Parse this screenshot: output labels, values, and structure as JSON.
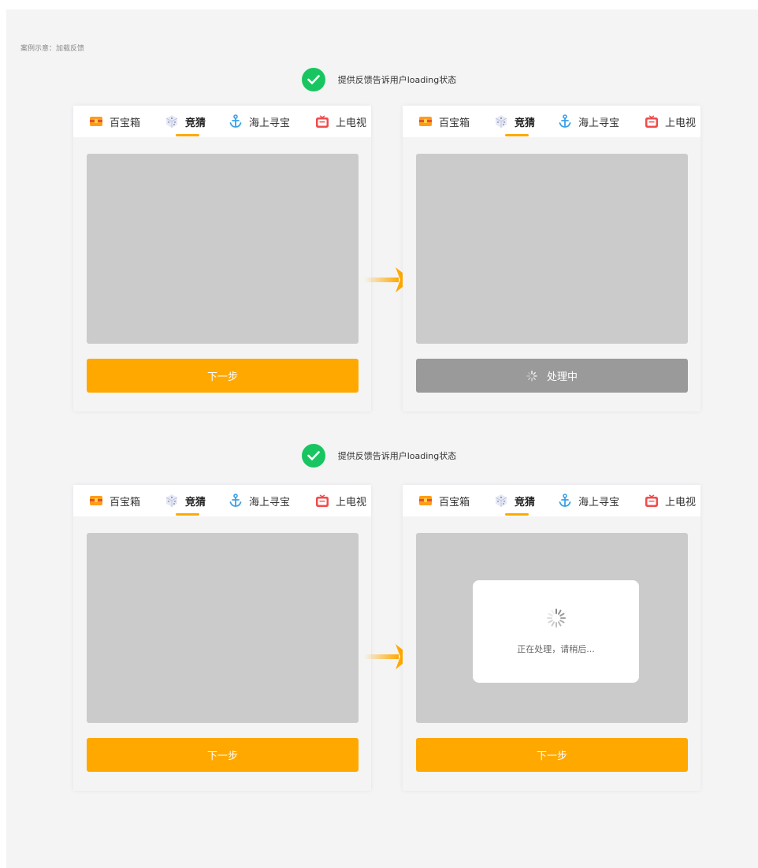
{
  "caption": "案例示意：加载反馈",
  "feedback": [
    {
      "text": "提供反馈告诉用户loading状态"
    },
    {
      "text": "提供反馈告诉用户loading状态"
    }
  ],
  "tabs": [
    {
      "label": "百宝箱",
      "icon": "treasure-chest-icon"
    },
    {
      "label": "竞猜",
      "icon": "dice-icon"
    },
    {
      "label": "海上寻宝",
      "icon": "anchor-icon"
    },
    {
      "label": "上电视",
      "icon": "tv-icon"
    }
  ],
  "buttons": {
    "next": "下一步",
    "processing": "处理中"
  },
  "toast": {
    "message": "正在处理，请稍后..."
  },
  "colors": {
    "accent": "#ffa900",
    "success": "#19c560",
    "disabled": "#9a9a9a",
    "placeholder": "#cbcbcb"
  }
}
